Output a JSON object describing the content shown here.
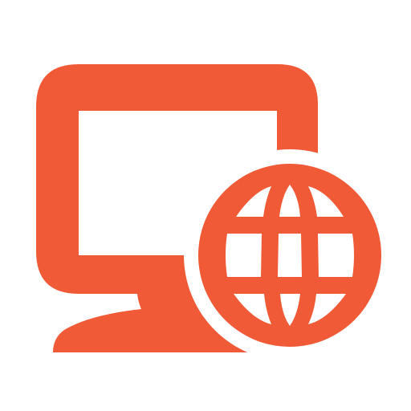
{
  "icon": {
    "name": "remote-desktop-globe-icon",
    "parts": [
      "monitor-icon",
      "globe-icon"
    ],
    "color": "#F05A36",
    "background": "#FFFFFF"
  }
}
